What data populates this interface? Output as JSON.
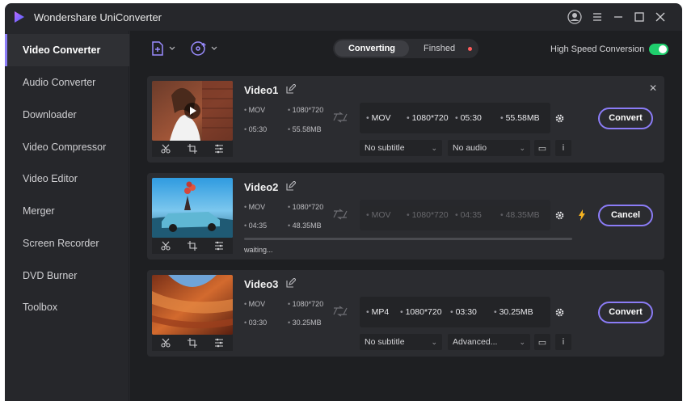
{
  "app": {
    "title": "Wondershare UniConverter"
  },
  "sidebar": {
    "items": [
      {
        "label": "Video Converter",
        "active": true
      },
      {
        "label": "Audio Converter"
      },
      {
        "label": "Downloader"
      },
      {
        "label": "Video Compressor"
      },
      {
        "label": "Video Editor"
      },
      {
        "label": "Merger"
      },
      {
        "label": "Screen Recorder"
      },
      {
        "label": "DVD Burner"
      },
      {
        "label": "Toolbox"
      }
    ]
  },
  "toolbar": {
    "tabs": {
      "converting": "Converting",
      "finished": "Finshed"
    },
    "high_speed_label": "High Speed Conversion",
    "high_speed_on": true
  },
  "videos": [
    {
      "name": "Video1",
      "src": {
        "format": "MOV",
        "resolution": "1080*720",
        "duration": "05:30",
        "size": "55.58MB"
      },
      "target": {
        "format": "MOV",
        "resolution": "1080*720",
        "duration": "05:30",
        "size": "55.58MB"
      },
      "subtitle": "No subtitle",
      "audio": "No audio",
      "action": "Convert"
    },
    {
      "name": "Video2",
      "src": {
        "format": "MOV",
        "resolution": "1080*720",
        "duration": "04:35",
        "size": "48.35MB"
      },
      "target": {
        "format": "MOV",
        "resolution": "1080*720",
        "duration": "04:35",
        "size": "48.35MB"
      },
      "status": "waiting...",
      "action": "Cancel"
    },
    {
      "name": "Video3",
      "src": {
        "format": "MOV",
        "resolution": "1080*720",
        "duration": "03:30",
        "size": "30.25MB"
      },
      "target": {
        "format": "MP4",
        "resolution": "1080*720",
        "duration": "03:30",
        "size": "30.25MB"
      },
      "subtitle": "No subtitle",
      "audio": "Advanced...",
      "action": "Convert"
    }
  ],
  "icons": {
    "accent": "#8b7cf6",
    "toggle_on": "#1fcf6d",
    "bolt": "#f5b321",
    "finished_dot": "#ff5c5c"
  }
}
